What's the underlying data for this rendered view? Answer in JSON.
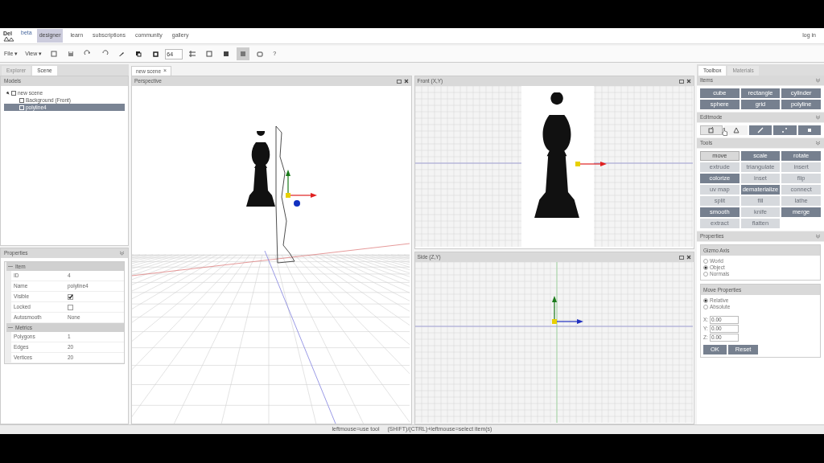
{
  "nav": {
    "logo": "Del",
    "beta": "beta",
    "links": [
      {
        "label": "designer",
        "selected": true
      },
      {
        "label": "learn",
        "selected": false
      },
      {
        "label": "subscriptions",
        "selected": false
      },
      {
        "label": "community",
        "selected": false
      },
      {
        "label": "gallery",
        "selected": false
      }
    ],
    "login": "log in"
  },
  "toolbar": {
    "menus": [
      "File ▾",
      "View ▾"
    ],
    "grid_size": "64",
    "help": "?"
  },
  "left_tabs": [
    {
      "label": "Explorer",
      "selected": false
    },
    {
      "label": "Scene",
      "selected": true
    }
  ],
  "models": {
    "title": "Models",
    "tree": [
      {
        "label": "new scene",
        "selected": false,
        "children": [
          {
            "label": "Background (Front)",
            "selected": false
          },
          {
            "label": "polyline4",
            "selected": true
          }
        ]
      }
    ]
  },
  "properties": {
    "title": "Properties",
    "groups": [
      {
        "title": "Item",
        "rows": [
          {
            "kind": "text",
            "label": "ID",
            "value": "4"
          },
          {
            "kind": "text",
            "label": "Name",
            "value": "polyline4"
          },
          {
            "kind": "checkbox",
            "label": "Visible",
            "checked": true
          },
          {
            "kind": "checkbox",
            "label": "Locked",
            "checked": false
          },
          {
            "kind": "text",
            "label": "Autosmooth",
            "value": "None"
          }
        ]
      },
      {
        "title": "Metrics",
        "rows": [
          {
            "kind": "text",
            "label": "Polygons",
            "value": "1"
          },
          {
            "kind": "text",
            "label": "Edges",
            "value": "20"
          },
          {
            "kind": "text",
            "label": "Vertices",
            "value": "20"
          }
        ]
      }
    ]
  },
  "doc_tab": {
    "label": "new scene",
    "close": "×"
  },
  "viewports": [
    {
      "kind": "perspective",
      "title": "Perspective"
    },
    {
      "kind": "front",
      "title": "Front (X,Y)"
    },
    {
      "kind": "side",
      "title": "Side (Z,Y)"
    }
  ],
  "right_tabs": [
    {
      "label": "Toolbox",
      "selected": true
    },
    {
      "label": "Materials",
      "selected": false
    }
  ],
  "items": {
    "title": "Items",
    "buttons": [
      "cube",
      "rectangle",
      "cylinder",
      "sphere",
      "grid",
      "polyline"
    ]
  },
  "editmode": {
    "title": "Editmode",
    "modes": [
      {
        "selected": true,
        "hovered": false
      },
      {
        "selected": false,
        "hovered": true
      },
      {
        "selected": false,
        "hovered": false
      },
      {
        "selected": false,
        "hovered": false
      },
      {
        "selected": false,
        "hovered": false
      }
    ]
  },
  "tools": {
    "title": "Tools",
    "buttons": [
      {
        "label": "move",
        "selected": true,
        "disabled": false
      },
      {
        "label": "scale",
        "selected": false,
        "disabled": false
      },
      {
        "label": "rotate",
        "selected": false,
        "disabled": false
      },
      {
        "label": "extrude",
        "selected": false,
        "disabled": true
      },
      {
        "label": "triangulate",
        "selected": false,
        "disabled": true
      },
      {
        "label": "insert",
        "selected": false,
        "disabled": true
      },
      {
        "label": "colorize",
        "selected": false,
        "disabled": false
      },
      {
        "label": "inset",
        "selected": false,
        "disabled": true
      },
      {
        "label": "flip",
        "selected": false,
        "disabled": true
      },
      {
        "label": "uv map",
        "selected": false,
        "disabled": true
      },
      {
        "label": "dematerialize",
        "selected": false,
        "disabled": false
      },
      {
        "label": "connect",
        "selected": false,
        "disabled": true
      },
      {
        "label": "split",
        "selected": false,
        "disabled": true
      },
      {
        "label": "fill",
        "selected": false,
        "disabled": true
      },
      {
        "label": "lathe",
        "selected": false,
        "disabled": true
      },
      {
        "label": "smooth",
        "selected": false,
        "disabled": false
      },
      {
        "label": "knife",
        "selected": false,
        "disabled": true
      },
      {
        "label": "merge",
        "selected": false,
        "disabled": false
      },
      {
        "label": "extract",
        "selected": false,
        "disabled": true
      },
      {
        "label": "flatten",
        "selected": false,
        "disabled": true
      }
    ]
  },
  "tool_properties": {
    "title": "Properties",
    "gizmo": {
      "title": "Gizmo Axis",
      "options": [
        {
          "label": "World",
          "selected": false
        },
        {
          "label": "Object",
          "selected": true
        },
        {
          "label": "Normals",
          "selected": false
        }
      ]
    },
    "move": {
      "title": "Move Properties",
      "options": [
        {
          "label": "Relative",
          "selected": true
        },
        {
          "label": "Absolute",
          "selected": false
        }
      ],
      "fields": [
        {
          "label": "X:",
          "value": "0.00"
        },
        {
          "label": "Y:",
          "value": "0.00"
        },
        {
          "label": "Z:",
          "value": "0.00"
        }
      ],
      "buttons": [
        "OK",
        "Reset"
      ]
    }
  },
  "status_bar": [
    "leftmouse=use tool",
    "(SHIFT)/(CTRL)+leftmouse=select item(s)"
  ]
}
